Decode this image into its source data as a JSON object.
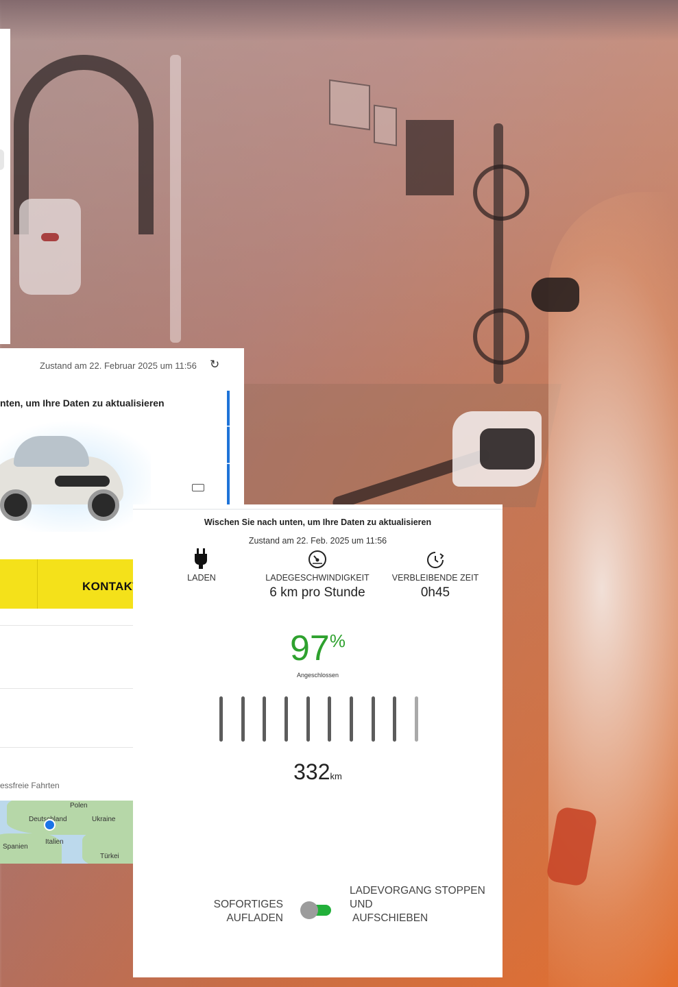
{
  "app_card": {
    "status": "Zustand am 22. Februar 2025 um 11:56",
    "swipe_hint": "nten, um Ihre Daten zu aktualisieren",
    "contact_label": "KONTAKT",
    "stressfree_text": "essfreie Fahrten",
    "map_labels": [
      "Polen",
      "Deutschland",
      "Ukraine",
      "Spanien",
      "Italien",
      "Türkei"
    ]
  },
  "charging": {
    "swipe_hint": "Wischen Sie nach unten, um Ihre Daten zu aktualisieren",
    "status": "Zustand am 22. Feb. 2025 um 11:56",
    "columns": [
      {
        "label": "LADEN",
        "value": "",
        "icon": "plug-icon"
      },
      {
        "label": "LADEGESCHWINDIGKEIT",
        "value": "6 km pro Stunde",
        "icon": "speedometer-icon"
      },
      {
        "label": "VERBLEIBENDE ZEIT",
        "value": "0h45",
        "icon": "clock-icon"
      }
    ],
    "battery_percent": "97",
    "percent_symbol": "%",
    "battery_fraction": 0.97,
    "plug_status": "Angeschlossen",
    "range_value": "332",
    "range_unit": "km",
    "toggle_left_label": "SOFORTIGES AUFLADEN",
    "toggle_right_label_line1": "LADEVORGANG STOPPEN UND",
    "toggle_right_label_line2": "AUFSCHIEBEN",
    "colors": {
      "accent_green": "#2ea12e",
      "toggle_green": "#22b03a",
      "yellow": "#f4e11a",
      "blue": "#1e73d8"
    }
  }
}
